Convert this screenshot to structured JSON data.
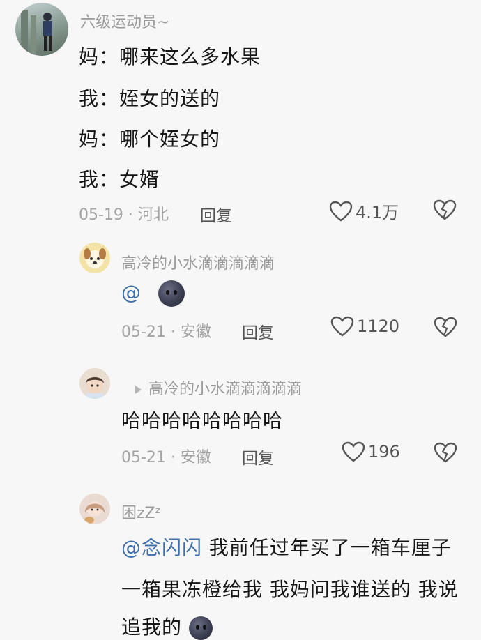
{
  "comments": [
    {
      "username": "六级运动员~",
      "lines": [
        "妈：哪来这么多水果",
        "我：姪女的送的",
        "妈：哪个姪女的",
        "我：女婿"
      ],
      "date": "05-19 · 河北",
      "reply_label": "回复",
      "likes": "4.1万"
    },
    {
      "username": "高冷的小水滴滴滴滴滴",
      "mention": "@",
      "date": "05-21 · 安徽",
      "reply_label": "回复",
      "likes": "1120"
    },
    {
      "username": "高冷的小水滴滴滴滴滴",
      "text": "哈哈哈哈哈哈哈哈",
      "date": "05-21 · 安徽",
      "reply_label": "回复",
      "likes": "196"
    },
    {
      "username": "困zZᶻ",
      "mention": "@念闪闪",
      "text_line1": " 我前任过年买了一箱车厘子",
      "text_line2": "一箱果冻橙给我 我妈问我谁送的 我说",
      "text_line3": "追我的"
    }
  ],
  "colors": {
    "mention": "#3f6fa8",
    "meta": "#a3a3a3",
    "background": "#f7f7f7"
  },
  "icons": [
    "heart-outline-icon",
    "broken-heart-icon",
    "dark-moon-emoji",
    "reply-arrow-icon"
  ]
}
